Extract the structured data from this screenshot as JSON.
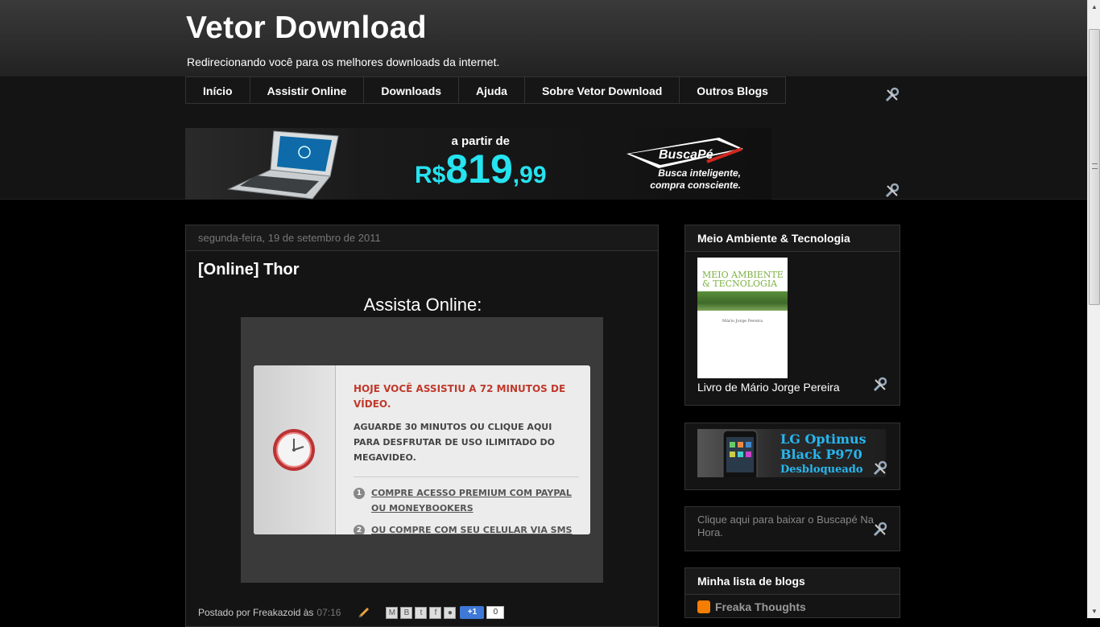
{
  "header": {
    "title": "Vetor Download",
    "description": "Redirecionando você para os melhores downloads da internet."
  },
  "nav": {
    "tabs": [
      "Início",
      "Assistir Online",
      "Downloads",
      "Ajuda",
      "Sobre Vetor Download",
      "Outros Blogs"
    ]
  },
  "banner": {
    "prefix": "a partir de",
    "currency": "R$",
    "price": "819",
    "cents": ",99",
    "brand": "BuscaPé",
    "tagline_1": "Busca inteligente,",
    "tagline_2": "compra consciente."
  },
  "post": {
    "date": "segunda-feira, 19 de setembro de 2011",
    "title": "[Online] Thor",
    "watch_label": "Assista Online:",
    "dialog": {
      "headline": "HOJE VOCÊ ASSISTIU A 72 MINUTOS DE VÍDEO.",
      "wait_text": "AGUARDE 30 MINUTOS OU CLIQUE AQUI PARA DESFRUTAR DE USO ILIMITADO DO MEGAVIDEO.",
      "option1_num": "1",
      "option1": "COMPRE ACESSO PREMIUM COM PAYPAL OU MONEYBOOKERS",
      "option2_num": "2",
      "option2": "OU COMPRE COM SEU CELULAR VIA SMS"
    },
    "footer": {
      "posted_by": "Postado por Freakazoid às",
      "time": "07:16",
      "plusone_label": "+1",
      "plusone_count": "0"
    }
  },
  "sidebar": {
    "widget1": {
      "title": "Meio Ambiente & Tecnologia",
      "book_title_1": "MEIO AMBIENTE",
      "book_title_2": "& TECNOLOGIA",
      "book_author": "Mário Jorge Pereira",
      "caption": "Livro de Mário Jorge Pereira"
    },
    "widget2": {
      "ad_line1": "LG Optimus",
      "ad_line2": "Black P970",
      "ad_line3": "Desbloqueado"
    },
    "widget3": {
      "link_text": "Clique aqui para baixar o Buscapé Na Hora."
    },
    "widget4": {
      "title": "Minha lista de blogs",
      "blog_name": "Freaka Thoughts"
    }
  },
  "colors": {
    "background": "#000000",
    "header_gradient_top": "#3a3a3a",
    "price_cyan": "#26e3f0",
    "dialog_red": "#c0392b",
    "lg_blue": "#27b7f0",
    "blogger_orange": "#f57d00"
  },
  "icons": {
    "wrench": "wrench-screwdriver-icon",
    "clock": "clock-icon",
    "pencil": "edit-pencil-icon",
    "blogger": "blogger-icon"
  }
}
